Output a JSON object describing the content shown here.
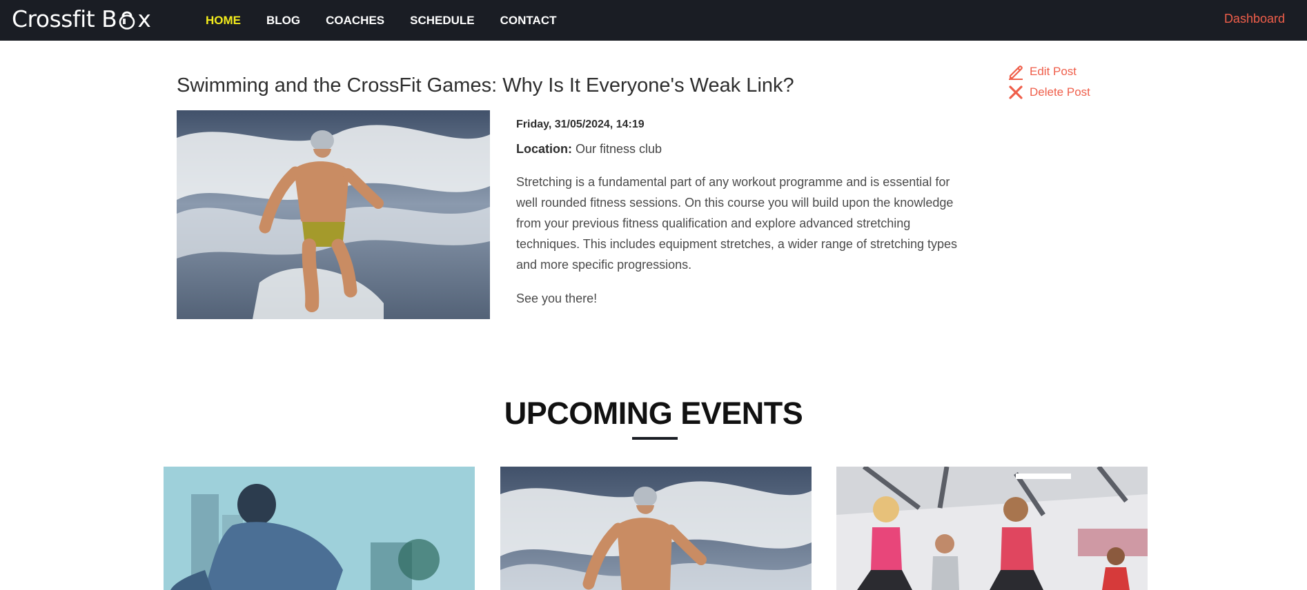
{
  "nav": {
    "brand": "Crossfit B  x",
    "brand_before": "Crossfit B",
    "brand_after": "x",
    "links": [
      "HOME",
      "BLOG",
      "COACHES",
      "SCHEDULE",
      "CONTACT"
    ],
    "active_link": "HOME",
    "dashboard": "Dashboard"
  },
  "post": {
    "title": "Swimming and the CrossFit Games: Why Is It Everyone's Weak Link?",
    "date": "Friday, 31/05/2024, 14:19",
    "location_label": "Location:",
    "location_value": "Our fitness club",
    "body": "Stretching is a fundamental part of any workout programme and is essential for well rounded fitness sessions. On this course you will build upon the knowledge from your previous fitness qualification and explore advanced stretching techniques. This includes equipment stretches, a wider range of stretching types and more specific progressions.",
    "signoff": "See you there!",
    "actions": {
      "edit": "Edit Post",
      "delete": "Delete Post"
    }
  },
  "events": {
    "title": "UPCOMING EVENTS"
  },
  "colors": {
    "navbar_bg": "#1a1d24",
    "active_link": "#f3ec1c",
    "accent": "#ef5e4a"
  },
  "icons": [
    "kettlebell-icon",
    "pencil-icon",
    "close-icon"
  ]
}
